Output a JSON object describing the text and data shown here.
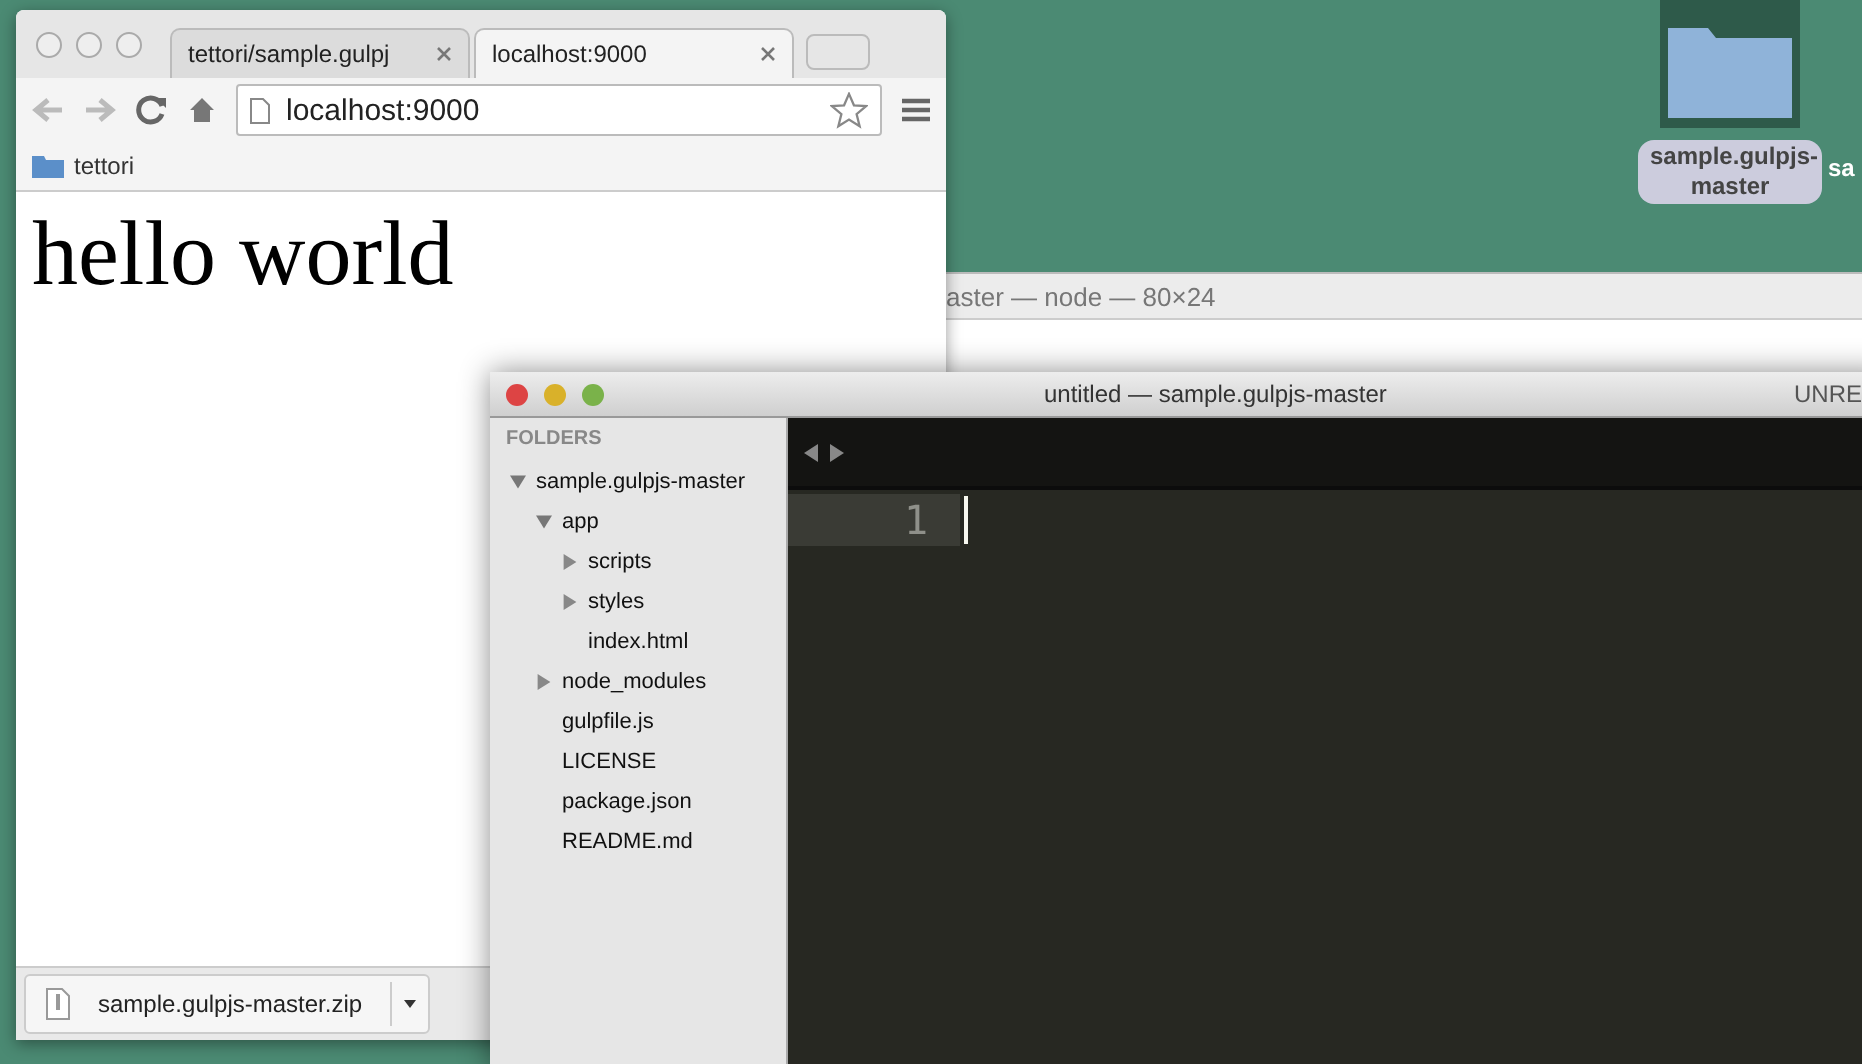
{
  "desktop_icons": [
    {
      "label": "sample.gulpjs-master",
      "selected": true
    }
  ],
  "cut_off_icon_label": "sa",
  "browser": {
    "tabs": [
      {
        "title": "tettori/sample.gulpj",
        "selected": false
      },
      {
        "title": "localhost:9000",
        "selected": true
      }
    ],
    "address": "localhost:9000",
    "bookmarks": [
      "tettori"
    ],
    "page_heading": "hello world",
    "download": {
      "filename": "sample.gulpjs-master.zip"
    }
  },
  "terminal": {
    "title": "aster — node — 80×24"
  },
  "editor": {
    "title": "untitled — sample.gulpjs-master",
    "badge": "UNRE",
    "sidebar_heading": "FOLDERS",
    "line_numbers": [
      "1"
    ],
    "tree": [
      {
        "label": "sample.gulpjs-master",
        "kind": "folder",
        "expanded": true,
        "children": [
          {
            "label": "app",
            "kind": "folder",
            "expanded": true,
            "children": [
              {
                "label": "scripts",
                "kind": "folder",
                "expanded": false
              },
              {
                "label": "styles",
                "kind": "folder",
                "expanded": false
              },
              {
                "label": "index.html",
                "kind": "file"
              }
            ]
          },
          {
            "label": "node_modules",
            "kind": "folder",
            "expanded": false
          },
          {
            "label": "gulpfile.js",
            "kind": "file"
          },
          {
            "label": "LICENSE",
            "kind": "file"
          },
          {
            "label": "package.json",
            "kind": "file"
          },
          {
            "label": "README.md",
            "kind": "file"
          }
        ]
      }
    ]
  }
}
